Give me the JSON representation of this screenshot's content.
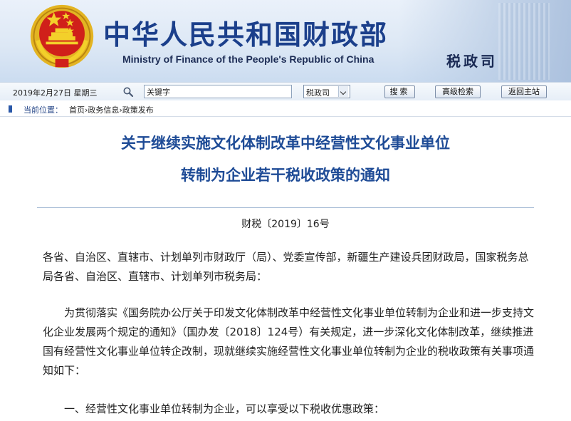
{
  "header": {
    "title_cn": "中华人民共和国财政部",
    "title_en": "Ministry of Finance of the People's Republic of China",
    "department": "税政司"
  },
  "toolbar": {
    "date": "2019年2月27日  星期三",
    "search_value": "关键字",
    "scope_selected": "税政司",
    "search_label": "搜索",
    "advanced_label": "高级检索",
    "home_label": "返回主站"
  },
  "breadcrumb": {
    "label": "当前位置：",
    "path": "首页›政务信息›政策发布"
  },
  "article": {
    "title_line1": "关于继续实施文化体制改革中经营性文化事业单位",
    "title_line2": "转制为企业若干税收政策的通知",
    "doc_number": "财税〔2019〕16号",
    "recipients": "各省、自治区、直辖市、计划单列市财政厅（局）、党委宣传部，新疆生产建设兵团财政局，国家税务总局各省、自治区、直辖市、计划单列市税务局：",
    "body_para1": "为贯彻落实《国务院办公厅关于印发文化体制改革中经营性文化事业单位转制为企业和进一步支持文化企业发展两个规定的通知》（国办发〔2018〕124号）有关规定，进一步深化文化体制改革，继续推进国有经营性文化事业单位转企改制，现就继续实施经营性文化事业单位转制为企业的税收政策有关事项通知如下：",
    "item1": "一、经营性文化事业单位转制为企业，可以享受以下税收优惠政策："
  },
  "colors": {
    "title_blue": "#1b3f8b",
    "article_title": "#1e4b96",
    "emblem_red": "#d0201a",
    "emblem_gold": "#e8b827"
  },
  "icons": {
    "emblem": "national-emblem",
    "search": "magnifier-icon"
  }
}
